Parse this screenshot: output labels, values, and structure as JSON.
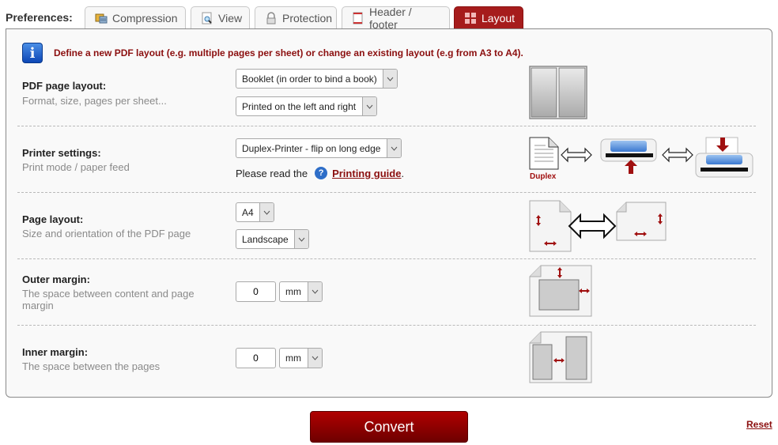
{
  "preferences_label": "Preferences:",
  "tabs": [
    {
      "label": "Compression",
      "icon": "compression-icon",
      "active": false
    },
    {
      "label": "View",
      "icon": "view-magnifier-icon",
      "active": false
    },
    {
      "label": "Protection",
      "icon": "lock-icon",
      "active": false
    },
    {
      "label": "Header / footer",
      "icon": "header-footer-page-icon",
      "active": false
    },
    {
      "label": "Layout",
      "icon": "layout-grid-icon",
      "active": true
    }
  ],
  "info": {
    "icon": "info-icon",
    "icon_glyph": "i",
    "text": "Define a new PDF layout (e.g. multiple pages per sheet) or change an existing layout (e.g from A3 to A4)."
  },
  "sections": {
    "pdf_layout": {
      "title": "PDF page layout:",
      "description": "Format, size, pages per sheet...",
      "layout_select": "Booklet (in order to bind a book)",
      "side_select": "Printed on the left and right"
    },
    "printer": {
      "title": "Printer settings:",
      "description": "Print mode / paper feed",
      "mode_select": "Duplex-Printer - flip on long edge",
      "guide_prefix": "Please read the",
      "help_glyph": "?",
      "guide_link": "Printing guide",
      "guide_suffix": ".",
      "duplex_label": "Duplex"
    },
    "page_layout": {
      "title": "Page layout:",
      "description": "Size and orientation of the PDF page",
      "size_select": "A4",
      "orientation_select": "Landscape"
    },
    "outer_margin": {
      "title": "Outer margin:",
      "description": "The space between content and page margin",
      "value": "0",
      "unit": "mm"
    },
    "inner_margin": {
      "title": "Inner margin:",
      "description": "The space between the pages",
      "value": "0",
      "unit": "mm"
    }
  },
  "actions": {
    "convert": "Convert",
    "reset": "Reset"
  },
  "colors": {
    "accent": "#a61c1c",
    "info_text": "#8b0f0f",
    "convert_top": "#b00000",
    "convert_bottom": "#6e0000"
  }
}
